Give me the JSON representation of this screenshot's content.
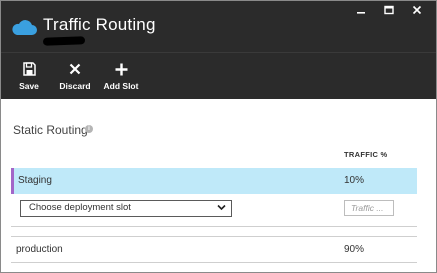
{
  "window": {
    "title": "Traffic Routing",
    "controls": [
      "minimize-icon",
      "maximize-icon",
      "close-icon"
    ]
  },
  "toolbar": {
    "save_label": "Save",
    "discard_label": "Discard",
    "add_slot_label": "Add Slot"
  },
  "section": {
    "title": "Static Routing",
    "column_header": "TRAFFIC %"
  },
  "routes": {
    "staging": {
      "name": "Staging",
      "traffic": "10%",
      "selected": true
    },
    "new_slot": {
      "select_value": "Choose deployment slot",
      "traffic_placeholder": "Traffic ..."
    },
    "production": {
      "name": "production",
      "traffic": "90%"
    }
  },
  "colors": {
    "header_bg": "#2b2b2b",
    "selected_row_bg": "#bfe9f9",
    "selected_row_accent": "#a266c8",
    "cloud_icon": "#3aa0e0"
  }
}
